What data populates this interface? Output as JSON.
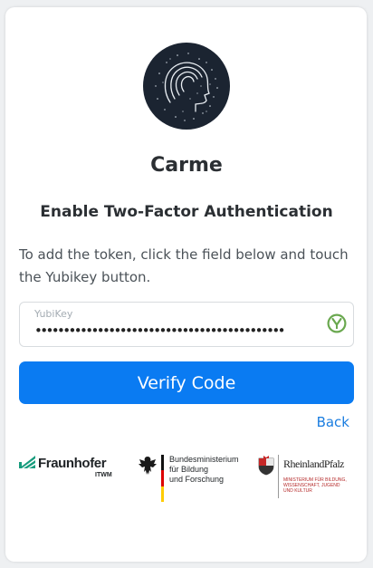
{
  "app": {
    "name": "Carme"
  },
  "page": {
    "subtitle": "Enable Two-Factor Authentication",
    "description": "To add the token, click the field below and touch the Yubikey button."
  },
  "token_field": {
    "label": "YubiKey",
    "value": "••••••••••••••••••••••••••••••••••••••••••••"
  },
  "actions": {
    "verify_label": "Verify Code",
    "back_label": "Back"
  },
  "colors": {
    "primary": "#0a7bf2",
    "link": "#1a7de0",
    "yubikey_green": "#6aa84f"
  },
  "sponsors": {
    "fraunhofer": {
      "name": "Fraunhofer",
      "unit": "ITWM"
    },
    "bmbf": {
      "text": "Bundesministerium\nfür Bildung\nund Forschung"
    },
    "rlp": {
      "name": "RheinlandPfalz",
      "ministry": "MINISTERIUM FÜR BILDUNG,\nWISSENSCHAFT, JUGEND\nUND KULTUR"
    }
  }
}
